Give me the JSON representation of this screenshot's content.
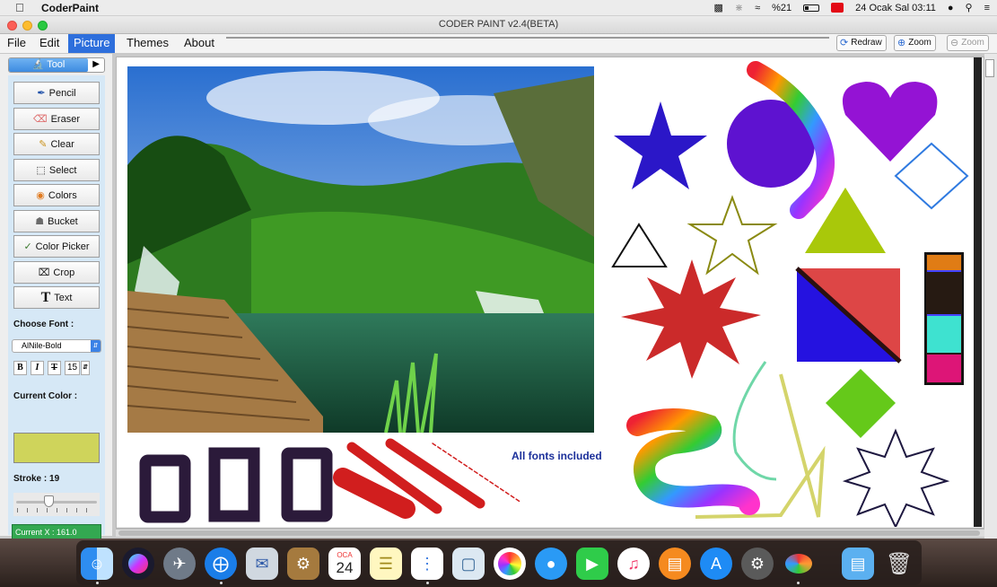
{
  "menubar": {
    "app_name": "CoderPaint",
    "battery": "%21",
    "datetime": "24 Ocak Sal 03:11"
  },
  "window": {
    "title": "CODER PAINT v2.4(BETA)"
  },
  "menu": {
    "items": [
      "File",
      "Edit",
      "Picture",
      "Themes",
      "About"
    ],
    "active": "Picture"
  },
  "toolbar": {
    "redraw": "Redraw",
    "zoom_in": "Zoom",
    "zoom_out": "Zoom"
  },
  "tools": {
    "header": "Tool",
    "pencil": "Pencil",
    "eraser": "Eraser",
    "clear": "Clear",
    "select": "Select",
    "colors": "Colors",
    "bucket": "Bucket",
    "color_picker": "Color Picker",
    "crop": "Crop",
    "text": "Text"
  },
  "font": {
    "label": "Choose Font :",
    "selected": "AlNile-Bold",
    "bold": "B",
    "italic": "I",
    "strike": "T",
    "size": "15"
  },
  "color": {
    "label": "Current Color :",
    "value": "#cfd45b"
  },
  "stroke": {
    "label": "Stroke : 19",
    "level": 19
  },
  "status": {
    "current_x": "Current X : 161.0"
  },
  "canvas": {
    "caption": "All fonts included"
  },
  "dock": {
    "calendar_month": "OCA",
    "calendar_day": "24",
    "apps": [
      "finder-icon",
      "siri-icon",
      "launchpad-icon",
      "safari-icon",
      "mail-icon",
      "contacts-icon",
      "calendar-icon",
      "notes-icon",
      "reminders-icon",
      "preview-icon",
      "photos-icon",
      "messages-icon",
      "facetime-icon",
      "itunes-icon",
      "ibooks-icon",
      "app-store-icon",
      "system-preferences-icon",
      "coderpaint-icon",
      "downloads-folder-icon",
      "trash-icon"
    ]
  }
}
